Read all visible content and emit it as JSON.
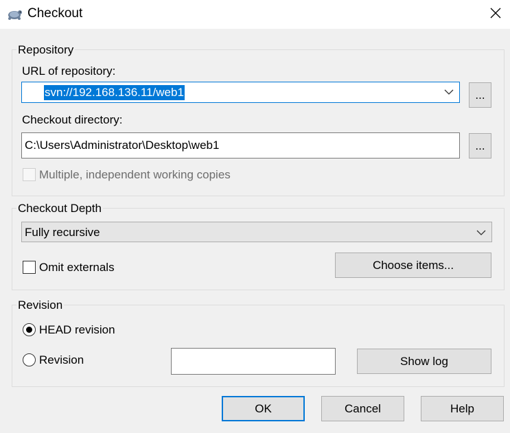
{
  "window": {
    "title": "Checkout",
    "icon": "tortoise-icon",
    "close_glyph": "✕"
  },
  "repository": {
    "group_label": "Repository",
    "url_label": "URL of repository:",
    "url_value": "svn://192.168.136.11/web1",
    "url_browse_label": "...",
    "dir_label": "Checkout directory:",
    "dir_value": "C:\\Users\\Administrator\\Desktop\\web1",
    "dir_browse_label": "...",
    "multiple_label": "Multiple, independent working copies",
    "multiple_checked": false
  },
  "depth": {
    "group_label": "Checkout Depth",
    "selected": "Fully recursive",
    "omit_externals_label": "Omit externals",
    "omit_externals_checked": false,
    "choose_items_label": "Choose items..."
  },
  "revision": {
    "group_label": "Revision",
    "head_label": "HEAD revision",
    "revision_label": "Revision",
    "revision_value": "",
    "selected": "head",
    "show_log_label": "Show log"
  },
  "footer": {
    "ok_label": "OK",
    "cancel_label": "Cancel",
    "help_label": "Help"
  },
  "colors": {
    "accent": "#0078d7",
    "background": "#f0f0f0"
  }
}
